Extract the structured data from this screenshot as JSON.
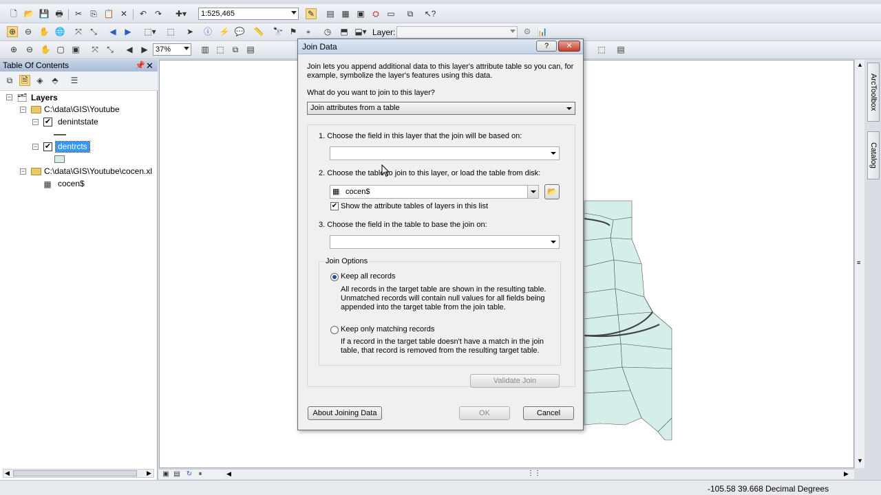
{
  "toolbar1": {
    "scale_value": "1:525,465"
  },
  "toolbar2": {
    "layer_label": "Layer:",
    "layer_value": ""
  },
  "toolbar3": {
    "zoom_value": "37%"
  },
  "toc": {
    "title": "Table Of Contents",
    "root_label": "Layers",
    "groups": [
      {
        "path": "C:\\data\\GIS\\Youtube",
        "layers": [
          {
            "name": "denintstate",
            "checked": true
          },
          {
            "name": "dentrcts",
            "checked": true,
            "selected": true
          }
        ]
      },
      {
        "path": "C:\\data\\GIS\\Youtube\\cocen.xl",
        "tables": [
          {
            "name": "cocen$"
          }
        ]
      }
    ]
  },
  "right_dock": {
    "tabs": [
      "ArcToolbox",
      "Catalog"
    ]
  },
  "status": {
    "coordinates": "-105.58  39.668 Decimal Degrees"
  },
  "dialog": {
    "title": "Join Data",
    "intro": "Join lets you append additional data to this layer's attribute table so you can, for example, symbolize the layer's features using this data.",
    "question": "What do you want to join to this layer?",
    "join_type": "Join attributes from a table",
    "step1": "1.  Choose the field in this layer that the join will be based on:",
    "step1_value": "",
    "step2": "2.  Choose the table to join to this layer, or load the table from disk:",
    "step2_value": "cocen$",
    "show_attr_tables": "Show the attribute tables of layers in this list",
    "step3": "3.  Choose the field in the table to base the join on:",
    "step3_value": "",
    "join_options_label": "Join Options",
    "opt_all_label": "Keep all records",
    "opt_all_desc": "All records in the target table are shown in the resulting table. Unmatched records will contain null values for all fields being appended into the target table from the join table.",
    "opt_match_label": "Keep only matching records",
    "opt_match_desc": "If a record in the target table doesn't have a match in the join table, that record is removed from the resulting target table.",
    "validate_label": "Validate Join",
    "about_label": "About Joining Data",
    "ok_label": "OK",
    "cancel_label": "Cancel",
    "help_label": "?",
    "close_label": "✕"
  },
  "colors": {
    "polygon_fill": "#d5eeea",
    "polygon_stroke": "#555555",
    "selection": "#3399ff"
  }
}
